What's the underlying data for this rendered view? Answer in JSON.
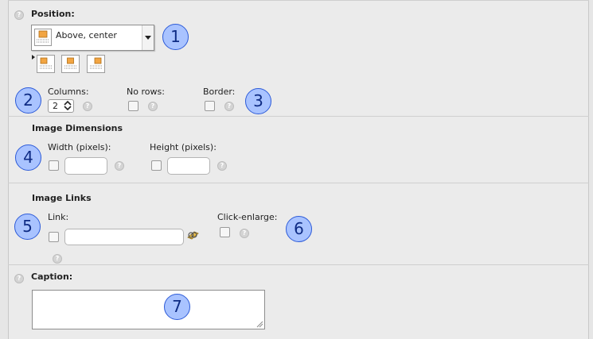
{
  "position": {
    "title": "Position:",
    "selected": "Above, center",
    "options": [
      "above-left-option",
      "above-center-option",
      "above-right-option"
    ]
  },
  "columns": {
    "label": "Columns:",
    "value": "2"
  },
  "no_rows": {
    "label": "No rows:"
  },
  "border": {
    "label": "Border:"
  },
  "image_dimensions": {
    "title": "Image Dimensions",
    "width_label": "Width (pixels):",
    "height_label": "Height (pixels):"
  },
  "image_links": {
    "title": "Image Links",
    "link_label": "Link:",
    "click_enlarge_label": "Click-enlarge:"
  },
  "caption": {
    "title": "Caption:"
  },
  "badges": [
    "1",
    "2",
    "3",
    "4",
    "5",
    "6",
    "7"
  ],
  "colors": {
    "badge_fill": "#a9c3ff",
    "badge_border": "#2d5bd8",
    "panel": "#ebebeb",
    "thumb_orange": "#f2a542"
  },
  "icons": {
    "help": "help-icon",
    "link_browser": "link-browser-icon"
  }
}
